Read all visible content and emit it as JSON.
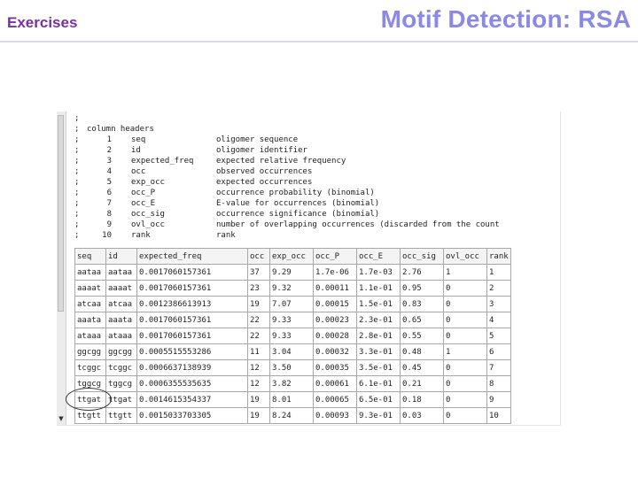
{
  "slide": {
    "label": "Exercises",
    "title": "Motif Detection: RSA"
  },
  "header_lines": [
    {
      "semi": ";",
      "num": "",
      "field": "",
      "desc": ""
    },
    {
      "semi": ";",
      "num": "column headers",
      "field": "",
      "desc": ""
    },
    {
      "semi": ";",
      "num": "1",
      "field": "seq",
      "desc": "oligomer sequence"
    },
    {
      "semi": ";",
      "num": "2",
      "field": "id",
      "desc": "oligomer identifier"
    },
    {
      "semi": ";",
      "num": "3",
      "field": "expected_freq",
      "desc": "expected relative frequency"
    },
    {
      "semi": ";",
      "num": "4",
      "field": "occ",
      "desc": "observed occurrences"
    },
    {
      "semi": ";",
      "num": "5",
      "field": "exp_occ",
      "desc": "expected occurrences"
    },
    {
      "semi": ";",
      "num": "6",
      "field": "occ_P",
      "desc": "occurrence probability (binomial)"
    },
    {
      "semi": ";",
      "num": "7",
      "field": "occ_E",
      "desc": "E-value for occurrences (binomial)"
    },
    {
      "semi": ";",
      "num": "8",
      "field": "occ_sig",
      "desc": "occurrence significance (binomial)"
    },
    {
      "semi": ";",
      "num": "9",
      "field": "ovl_occ",
      "desc": "number of overlapping occurrences (discarded from the count"
    },
    {
      "semi": ";",
      "num": "10",
      "field": "rank",
      "desc": "rank"
    }
  ],
  "table": {
    "columns": [
      "seq",
      "id",
      "expected_freq",
      "occ",
      "exp_occ",
      "occ_P",
      "occ_E",
      "occ_sig",
      "ovl_occ",
      "rank"
    ],
    "rows": [
      [
        "aataa",
        "aataa",
        "0.0017060157361",
        "37",
        "9.29",
        "1.7e-06",
        "1.7e-03",
        "2.76",
        "1",
        "1"
      ],
      [
        "aaaat",
        "aaaat",
        "0.0017060157361",
        "23",
        "9.32",
        "0.00011",
        "1.1e-01",
        "0.95",
        "0",
        "2"
      ],
      [
        "atcaa",
        "atcaa",
        "0.0012386613913",
        "19",
        "7.07",
        "0.00015",
        "1.5e-01",
        "0.83",
        "0",
        "3"
      ],
      [
        "aaata",
        "aaata",
        "0.0017060157361",
        "22",
        "9.33",
        "0.00023",
        "2.3e-01",
        "0.65",
        "0",
        "4"
      ],
      [
        "ataaa",
        "ataaa",
        "0.0017060157361",
        "22",
        "9.33",
        "0.00028",
        "2.8e-01",
        "0.55",
        "0",
        "5"
      ],
      [
        "ggcgg",
        "ggcgg",
        "0.0005515553286",
        "11",
        "3.04",
        "0.00032",
        "3.3e-01",
        "0.48",
        "1",
        "6"
      ],
      [
        "tcggc",
        "tcggc",
        "0.0006637138939",
        "12",
        "3.50",
        "0.00035",
        "3.5e-01",
        "0.45",
        "0",
        "7"
      ],
      [
        "tggcg",
        "tggcg",
        "0.0006355535635",
        "12",
        "3.82",
        "0.00061",
        "6.1e-01",
        "0.21",
        "0",
        "8"
      ],
      [
        "ttgat",
        "ttgat",
        "0.0014615354337",
        "19",
        "8.01",
        "0.00065",
        "6.5e-01",
        "0.18",
        "0",
        "9"
      ],
      [
        "ttgtt",
        "ttgtt",
        "0.0015033703305",
        "19",
        "8.24",
        "0.00093",
        "9.3e-01",
        "0.03",
        "0",
        "10"
      ]
    ]
  },
  "icons": {
    "scroll_down": "▼"
  }
}
